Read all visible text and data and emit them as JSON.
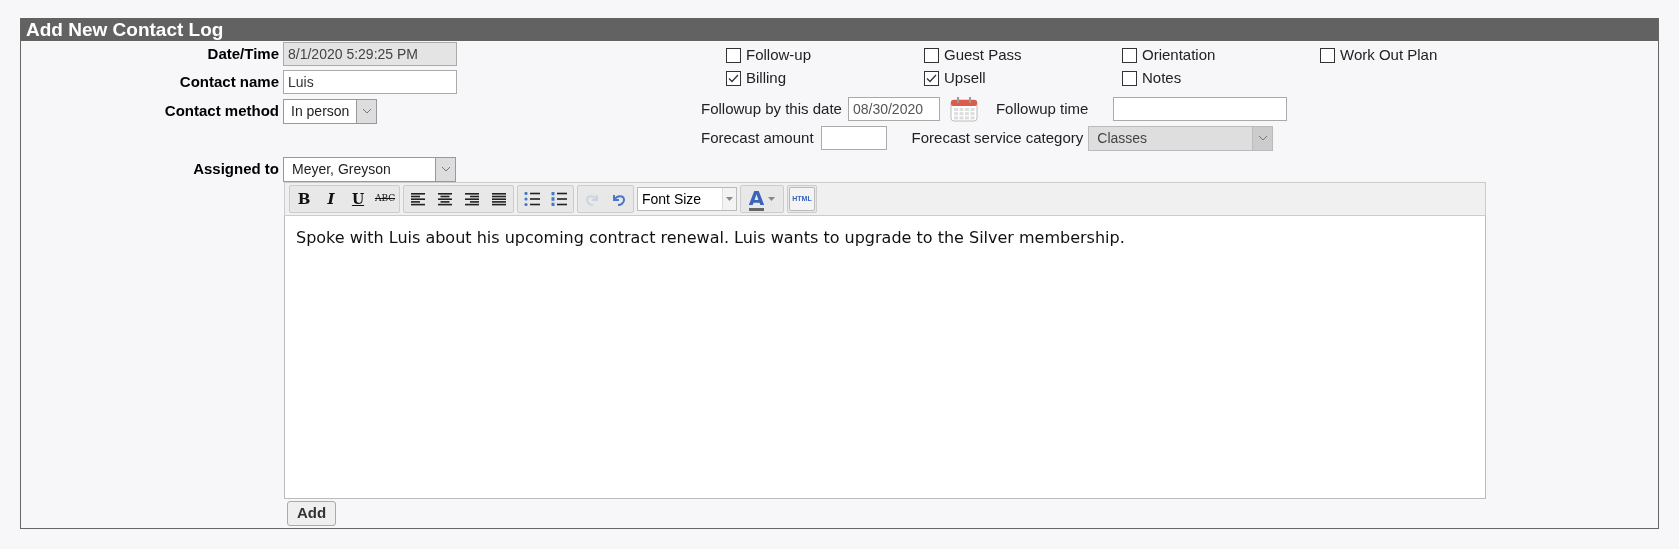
{
  "title": "Add New Contact Log",
  "fields": {
    "date_time": {
      "label": "Date/Time",
      "value": "8/1/2020 5:29:25 PM",
      "disabled": true
    },
    "contact_name": {
      "label": "Contact name",
      "value": "Luis"
    },
    "contact_method": {
      "label": "Contact method",
      "value": "In person"
    },
    "assigned_to": {
      "label": "Assigned to",
      "value": "Meyer, Greyson"
    }
  },
  "categories": [
    {
      "label": "Follow-up",
      "checked": false
    },
    {
      "label": "Guest Pass",
      "checked": false
    },
    {
      "label": "Orientation",
      "checked": false
    },
    {
      "label": "Work Out Plan",
      "checked": false
    },
    {
      "label": "Billing",
      "checked": true
    },
    {
      "label": "Upsell",
      "checked": true
    },
    {
      "label": "Notes",
      "checked": false
    }
  ],
  "followup": {
    "date_label": "Followup by this date",
    "date_value": "08/30/2020",
    "time_label": "Followup time"
  },
  "forecast": {
    "amount_label": "Forecast amount",
    "category_label": "Forecast service category",
    "category_value": "Classes",
    "category_disabled": true
  },
  "toolbar": [
    [
      {
        "kind": "bold",
        "label": "B",
        "disabled": false
      },
      {
        "kind": "italic",
        "label": "I",
        "disabled": false
      },
      {
        "kind": "underline",
        "label": "U",
        "disabled": false
      },
      {
        "kind": "strike",
        "label": "ABC",
        "disabled": false
      }
    ],
    [
      {
        "kind": "align-left",
        "disabled": false
      },
      {
        "kind": "align-center",
        "disabled": false
      },
      {
        "kind": "align-right",
        "disabled": false
      },
      {
        "kind": "justify",
        "disabled": false
      }
    ],
    [
      {
        "kind": "bullets",
        "disabled": false
      },
      {
        "kind": "numbers",
        "disabled": false
      }
    ],
    [
      {
        "kind": "redo",
        "disabled": true
      },
      {
        "kind": "undo",
        "disabled": false
      }
    ],
    [
      {
        "kind": "font-size",
        "label": "Font Size",
        "disabled": false
      }
    ],
    [
      {
        "kind": "font-color",
        "label": "A",
        "disabled": false
      }
    ],
    [
      {
        "kind": "html",
        "label": "HTML",
        "disabled": false
      }
    ]
  ],
  "editor_text": "Spoke with Luis about his upcoming contract renewal. Luis wants to upgrade to the Silver membership.",
  "add_button": "Add"
}
